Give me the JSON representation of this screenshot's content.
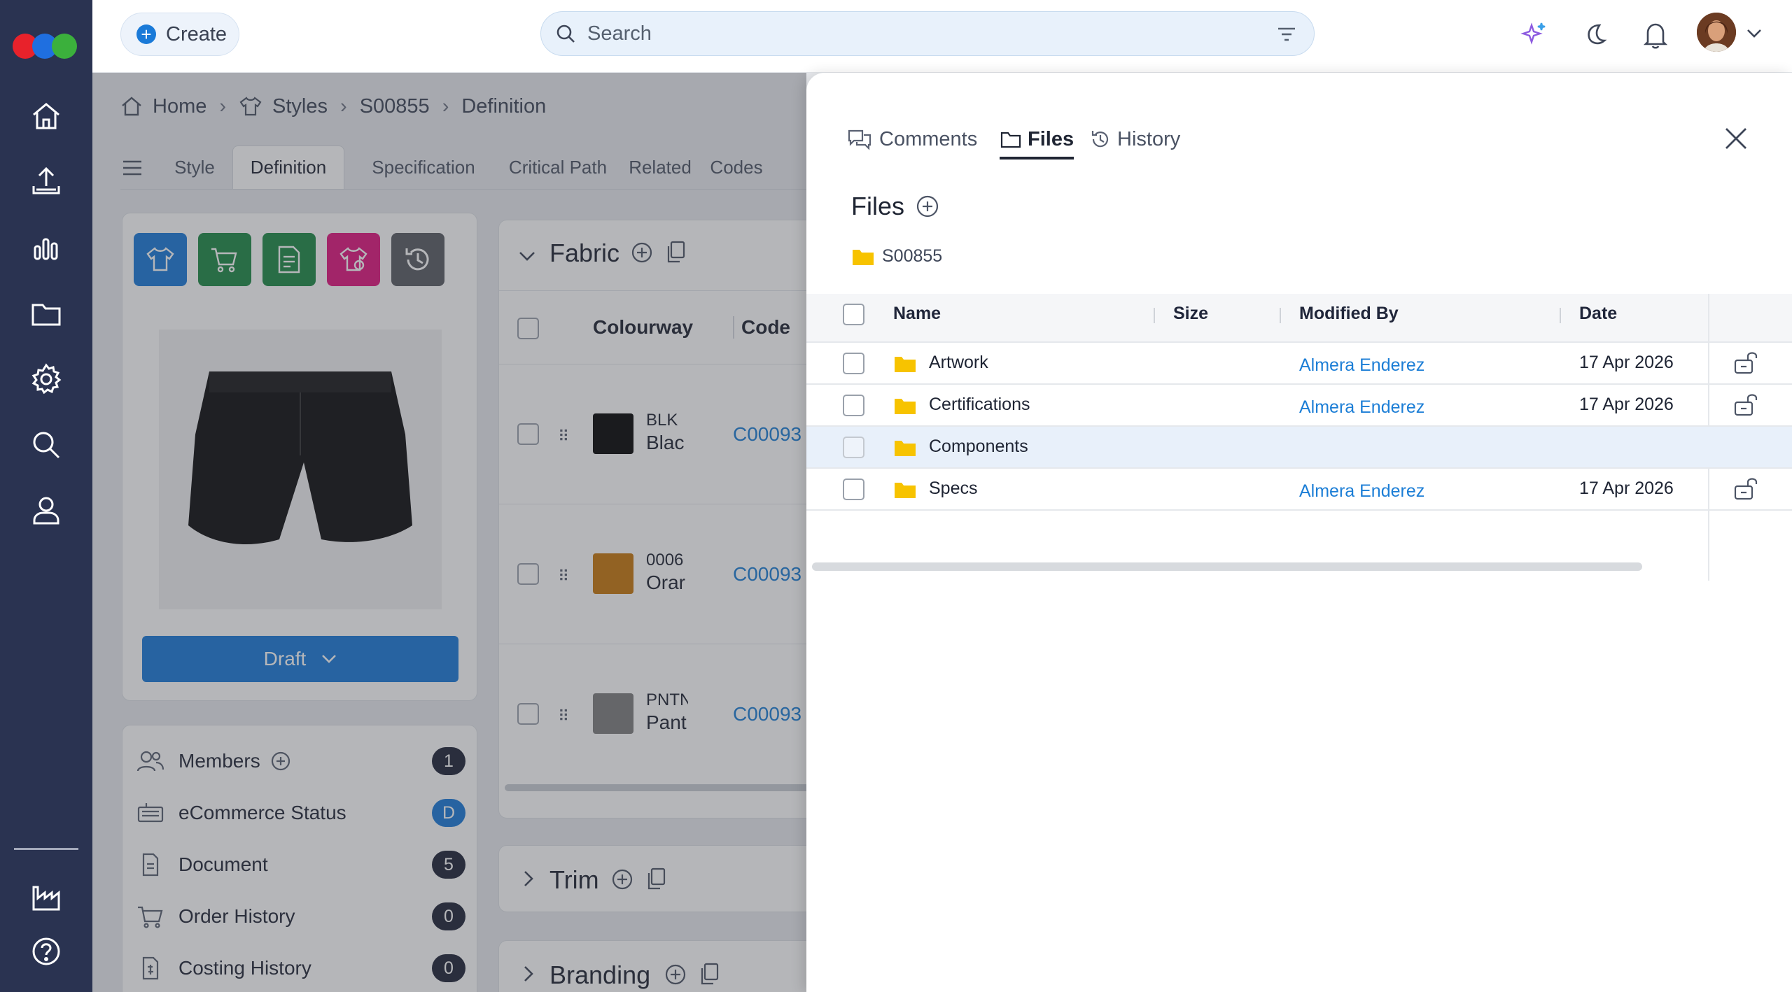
{
  "topbar": {
    "create_label": "Create",
    "search_placeholder": "Search"
  },
  "breadcrumb": [
    "Home",
    "Styles",
    "S00855",
    "Definition"
  ],
  "tabs": [
    "Style",
    "Definition",
    "Specification",
    "Critical Path",
    "Related",
    "Codes"
  ],
  "product": {
    "status_label": "Draft"
  },
  "sections": {
    "fabric": "Fabric",
    "trim": "Trim",
    "branding": "Branding",
    "col_colourway": "Colourway",
    "col_code": "Code"
  },
  "fabric_rows": [
    {
      "code_top": "BLK",
      "code_bottom": "Blac",
      "link": "C00093",
      "swatch": "#050505"
    },
    {
      "code_top": "0006",
      "code_bottom": "Orar",
      "link": "C00093",
      "swatch": "#c7780e"
    },
    {
      "code_top": "PNTN",
      "code_bottom": "Pant",
      "link": "C00093",
      "swatch": "#7f7f7f"
    }
  ],
  "summary": [
    {
      "label": "Members",
      "badge": "1"
    },
    {
      "label": "eCommerce Status",
      "badge": "D"
    },
    {
      "label": "Document",
      "badge": "5"
    },
    {
      "label": "Order History",
      "badge": "0"
    },
    {
      "label": "Costing History",
      "badge": "0"
    }
  ],
  "panel": {
    "tabs": [
      "Comments",
      "Files",
      "History"
    ],
    "active_tab": "Files",
    "title": "Files",
    "folder_path": "S00855",
    "columns": [
      "Name",
      "Size",
      "Modified By",
      "Date"
    ],
    "rows": [
      {
        "name": "Artwork",
        "size": "",
        "modified_by": "Almera Enderez",
        "date": "17 Apr 2026"
      },
      {
        "name": "Certifications",
        "size": "",
        "modified_by": "Almera Enderez",
        "date": "17 Apr 2026"
      },
      {
        "name": "Components",
        "size": "",
        "modified_by": "",
        "date": ""
      },
      {
        "name": "Specs",
        "size": "",
        "modified_by": "Almera Enderez",
        "date": "17 Apr 2026"
      }
    ]
  },
  "colors": {
    "nav_bg": "#2a3351",
    "accent": "#1a7ad8",
    "link": "#1c7ed6",
    "folder": "#f7c300",
    "highlight_row": "#e8f0fa"
  }
}
